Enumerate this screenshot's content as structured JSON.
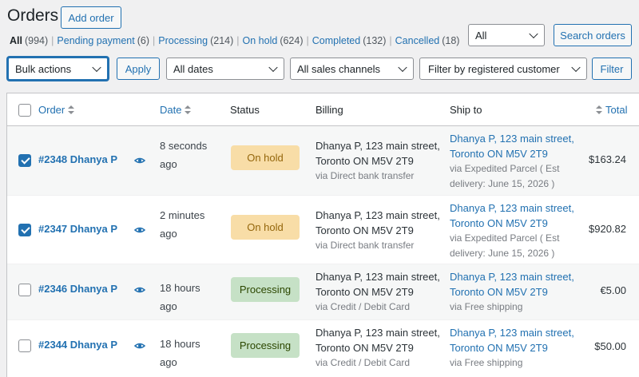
{
  "header": {
    "title": "Orders",
    "add_order": "Add order"
  },
  "views": [
    {
      "label": "All",
      "count": "(994)",
      "current": true
    },
    {
      "label": "Pending payment",
      "count": "(6)"
    },
    {
      "label": "Processing",
      "count": "(214)"
    },
    {
      "label": "On hold",
      "count": "(624)"
    },
    {
      "label": "Completed",
      "count": "(132)"
    },
    {
      "label": "Cancelled",
      "count": "(18)"
    }
  ],
  "search": {
    "status_select": "All",
    "button": "Search orders"
  },
  "filters": {
    "bulk_actions": "Bulk actions",
    "apply": "Apply",
    "dates": "All dates",
    "channels": "All sales channels",
    "customer": "Filter by registered customer",
    "filter": "Filter"
  },
  "columns": {
    "order": "Order",
    "date": "Date",
    "status": "Status",
    "billing": "Billing",
    "ship_to": "Ship to",
    "total": "Total"
  },
  "orders": [
    {
      "checked": true,
      "order": "#2348 Dhanya P",
      "date": "8 seconds ago",
      "status": "On hold",
      "status_type": "hold",
      "billing_line1": "Dhanya P, 123 main street,",
      "billing_line2": "Toronto ON M5V 2T9",
      "billing_via": "via Direct bank transfer",
      "ship_line1": "Dhanya P, 123 main street,",
      "ship_line2": "Toronto ON M5V 2T9",
      "ship_via": "via Expedited Parcel ( Est delivery: June 15, 2026 )",
      "total": "$163.24"
    },
    {
      "checked": true,
      "order": "#2347 Dhanya P",
      "date": "2 minutes ago",
      "status": "On hold",
      "status_type": "hold",
      "billing_line1": "Dhanya P, 123 main street,",
      "billing_line2": "Toronto ON M5V 2T9",
      "billing_via": "via Direct bank transfer",
      "ship_line1": "Dhanya P, 123 main street,",
      "ship_line2": "Toronto ON M5V 2T9",
      "ship_via": "via Expedited Parcel ( Est delivery: June 15, 2026 )",
      "total": "$920.82"
    },
    {
      "checked": false,
      "order": "#2346 Dhanya P",
      "date": "18 hours ago",
      "status": "Processing",
      "status_type": "proc",
      "billing_line1": "Dhanya P, 123 main street,",
      "billing_line2": "Toronto ON M5V 2T9",
      "billing_via": "via Credit / Debit Card",
      "ship_line1": "Dhanya P, 123 main street,",
      "ship_line2": "Toronto ON M5V 2T9",
      "ship_via": "via Free shipping",
      "total": "€5.00"
    },
    {
      "checked": false,
      "order": "#2344 Dhanya P",
      "date": "18 hours ago",
      "status": "Processing",
      "status_type": "proc",
      "billing_line1": "Dhanya P, 123 main street,",
      "billing_line2": "Toronto ON M5V 2T9",
      "billing_via": "via Credit / Debit Card",
      "ship_line1": "Dhanya P, 123 main street,",
      "ship_line2": "Toronto ON M5V 2T9",
      "ship_via": "via Free shipping",
      "total": "$50.00"
    }
  ]
}
